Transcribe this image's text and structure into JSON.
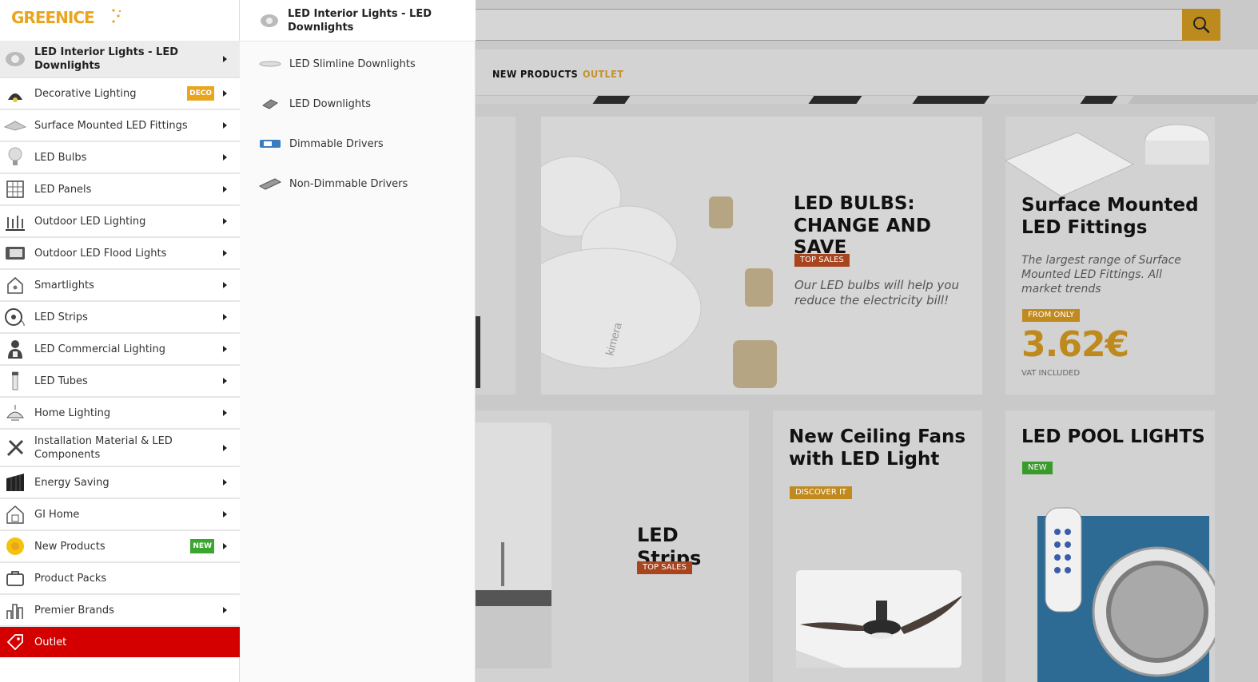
{
  "brand": {
    "logo_text": "GREENICE"
  },
  "search": {
    "placeholder": ""
  },
  "topnav": {
    "new_products": "NEW PRODUCTS",
    "outlet": "OUTLET"
  },
  "colors": {
    "accent": "#e8a51d",
    "outlet": "#d40000",
    "deco": "#e8a51d",
    "new": "#3aa52f"
  },
  "menu": {
    "items": [
      {
        "label": "LED Interior Lights - LED Downlights",
        "icon": "downlight-icon",
        "active": true
      },
      {
        "label": "Decorative Lighting",
        "icon": "pendant-lamp-icon",
        "badge": "DECO"
      },
      {
        "label": "Surface Mounted LED Fittings",
        "icon": "surface-fitting-icon"
      },
      {
        "label": "LED Bulbs",
        "icon": "bulb-icon"
      },
      {
        "label": "LED Panels",
        "icon": "panel-icon"
      },
      {
        "label": "Outdoor LED Lighting",
        "icon": "outdoor-light-icon"
      },
      {
        "label": "Outdoor LED Flood Lights",
        "icon": "floodlight-icon"
      },
      {
        "label": "Smartlights",
        "icon": "smart-home-icon"
      },
      {
        "label": "LED Strips",
        "icon": "strip-reel-icon"
      },
      {
        "label": "LED Commercial Lighting",
        "icon": "commercial-icon"
      },
      {
        "label": "LED Tubes",
        "icon": "tube-icon"
      },
      {
        "label": "Home Lighting",
        "icon": "ceiling-lamp-icon"
      },
      {
        "label": "Installation Material & LED Components",
        "icon": "tools-icon"
      },
      {
        "label": "Energy Saving",
        "icon": "solar-panel-icon"
      },
      {
        "label": "GI Home",
        "icon": "home-device-icon"
      },
      {
        "label": "New Products",
        "icon": "new-star-icon",
        "badge": "NEW"
      },
      {
        "label": "Product Packs",
        "icon": "pack-icon"
      },
      {
        "label": "Premier Brands",
        "icon": "brands-icon"
      },
      {
        "label": "Outlet",
        "icon": "tag-icon"
      }
    ]
  },
  "submenu": {
    "title": "LED Interior Lights - LED Downlights",
    "items": [
      {
        "label": "LED Slimline Downlights",
        "icon": "slim-downlight-icon"
      },
      {
        "label": "LED Downlights",
        "icon": "downlight-small-icon"
      },
      {
        "label": "Dimmable Drivers",
        "icon": "dimmable-driver-icon"
      },
      {
        "label": "Non-Dimmable Drivers",
        "icon": "driver-icon"
      }
    ]
  },
  "cards": {
    "bulbs": {
      "title": "LED BULBS: CHANGE AND SAVE",
      "tag": "TOP SALES",
      "desc": "Our LED bulbs will help you reduce the electricity bill!",
      "brand_mark": "kimera"
    },
    "surface": {
      "title": "Surface Mounted LED Fittings",
      "desc": "The largest range of Surface Mounted LED Fittings. All market trends",
      "tag": "FROM ONLY",
      "price": "3.62€",
      "vat": "VAT INCLUDED"
    },
    "strips": {
      "title": "LED Strips",
      "tag": "TOP SALES"
    },
    "fans": {
      "title": "New Ceiling Fans with LED Light",
      "tag": "DISCOVER IT"
    },
    "pool": {
      "title": "LED POOL LIGHTS",
      "tag": "NEW"
    }
  }
}
